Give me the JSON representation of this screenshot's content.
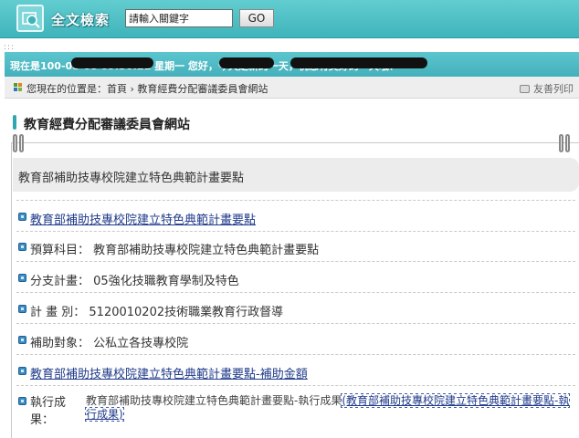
{
  "search": {
    "title": "全文檢索",
    "placeholder": "請輸入關鍵字",
    "go_label": "GO"
  },
  "info_bar": {
    "text": "現在是100-08-08 09:30:21 星期一 您好，今天是新的一天，祝您有美好的一天哦！"
  },
  "breadcrumb": {
    "prefix": "您現在的位置是：",
    "home": "首頁",
    "separator": "›",
    "current": "教育經費分配審議委員會網站"
  },
  "print": {
    "label": "友善列印"
  },
  "page": {
    "heading": "教育經費分配審議委員會網站",
    "section_title": "教育部補助技專校院建立特色典範計畫要點"
  },
  "rows": [
    {
      "kind": "link",
      "text": "教育部補助技專校院建立特色典範計畫要點"
    },
    {
      "kind": "field",
      "label": "預算科目：",
      "value": "教育部補助技專校院建立特色典範計畫要點"
    },
    {
      "kind": "field",
      "label": "分支計畫：",
      "value": "05強化技職教育學制及特色"
    },
    {
      "kind": "field",
      "label": "計 畫 別：",
      "value": "5120010202技術職業教育行政督導"
    },
    {
      "kind": "field",
      "label": "補助對象：",
      "value": "公私立各技專校院"
    },
    {
      "kind": "link",
      "text": "教育部補助技專校院建立特色典範計畫要點-補助金額"
    },
    {
      "kind": "result",
      "label": "執行成果：",
      "text": "教育部補助技專校院建立特色典範計畫要點-執行成果",
      "link_text": "(教育部補助技專校院建立特色典範計畫要點-執行成果)"
    }
  ]
}
